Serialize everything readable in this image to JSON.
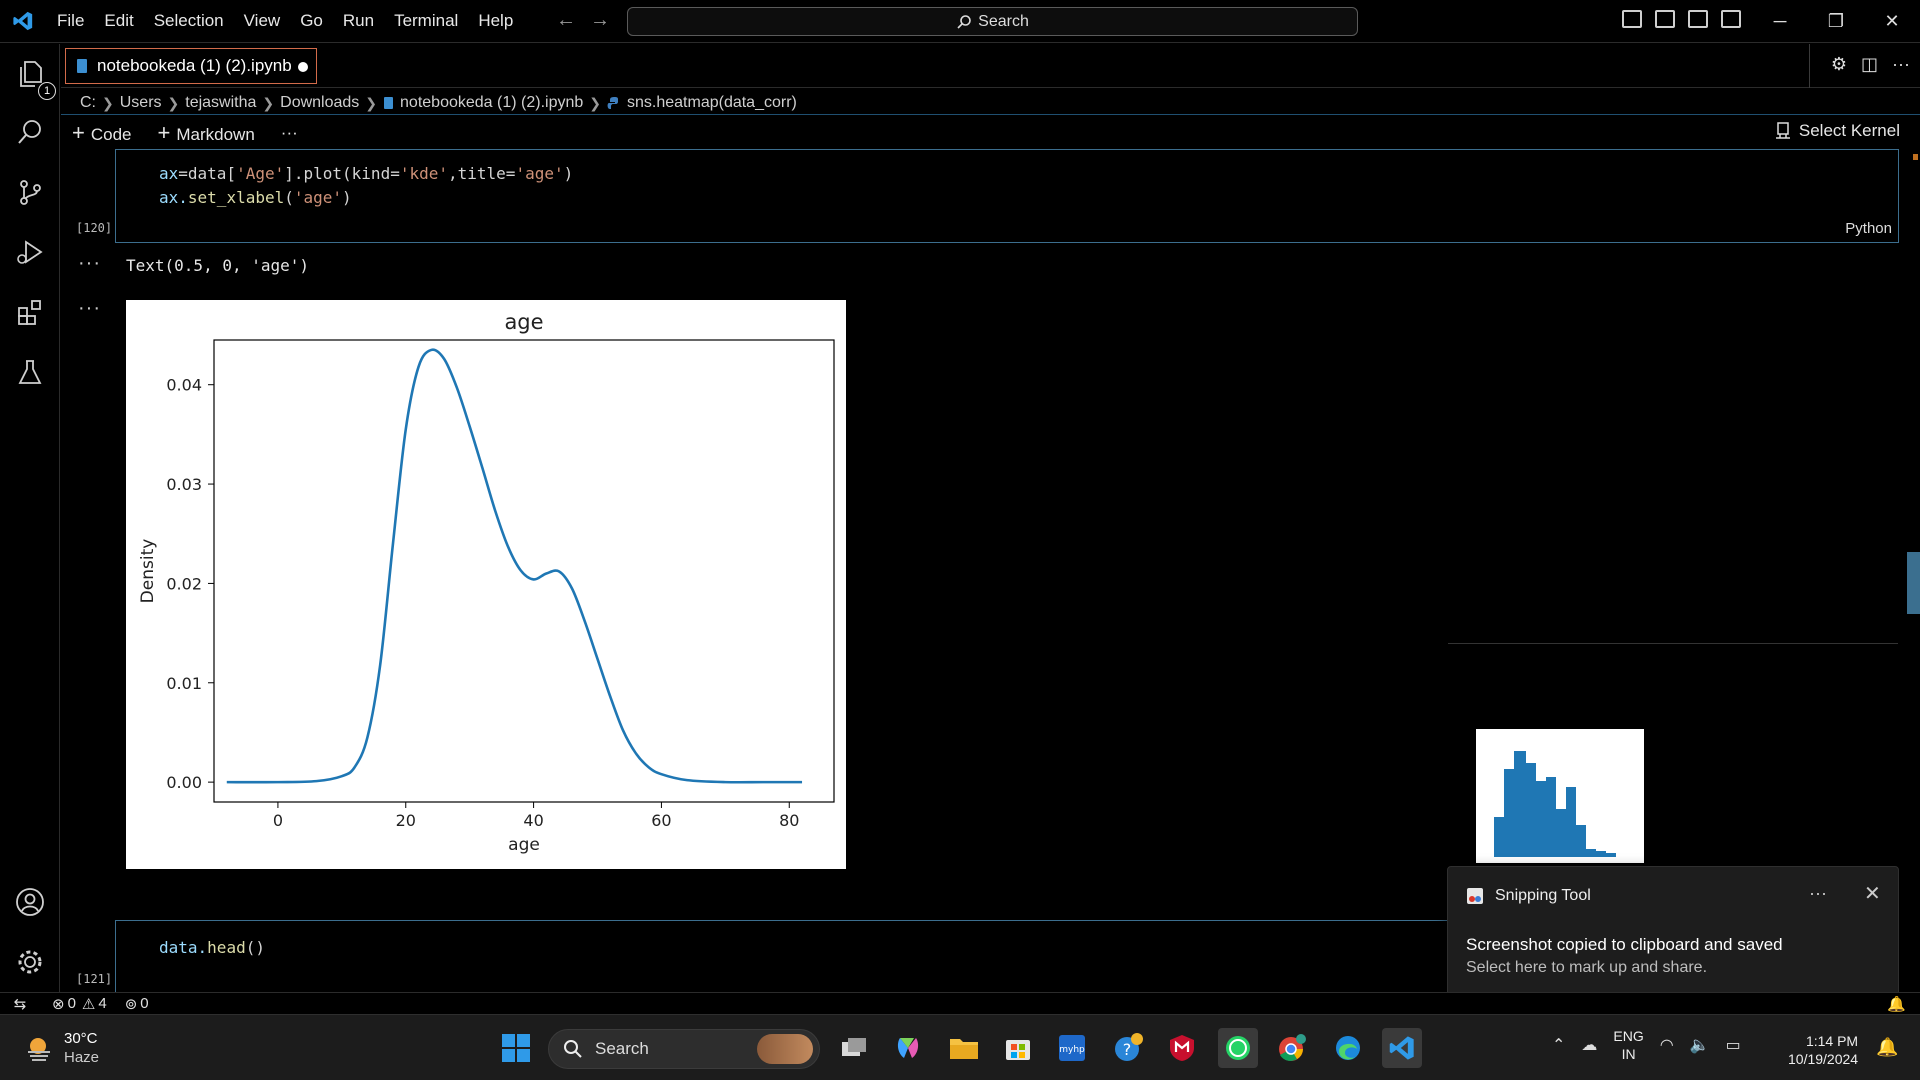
{
  "menu": [
    "File",
    "Edit",
    "Selection",
    "View",
    "Go",
    "Run",
    "Terminal",
    "Help"
  ],
  "search": {
    "label": "Search"
  },
  "tab": {
    "label": "notebookeda (1) (2).ipynb"
  },
  "explorer_badge": "1",
  "breadcrumb": [
    "C:",
    "Users",
    "tejaswitha",
    "Downloads",
    "notebookeda (1) (2).ipynb",
    "sns.heatmap(data_corr)"
  ],
  "toolbar": {
    "code": "Code",
    "markdown": "Markdown",
    "more": "···",
    "kernel": "Select Kernel"
  },
  "cell1": {
    "exec": "[120]",
    "lang": "Python",
    "line1": {
      "a": "ax",
      "b": "=data[",
      "c": "'Age'",
      "d": "].plot(kind=",
      "e": "'kde'",
      "f": ",title=",
      "g": "'age'",
      "h": ")"
    },
    "line2": {
      "a": "ax.",
      "b": "set_xlabel",
      "c": "(",
      "d": "'age'",
      "e": ")"
    }
  },
  "output": {
    "dots": "···",
    "text": "Text(0.5, 0, 'age')"
  },
  "chart_data": {
    "type": "line",
    "title": "age",
    "xlabel": "age",
    "ylabel": "Density",
    "xlim": [
      -10,
      87
    ],
    "ylim": [
      -0.002,
      0.0445
    ],
    "xticks": [
      0,
      20,
      40,
      60,
      80
    ],
    "yticks": [
      0.0,
      0.01,
      0.02,
      0.03,
      0.04
    ],
    "ytick_labels": [
      "0.00",
      "0.01",
      "0.02",
      "0.03",
      "0.04"
    ],
    "xtick_labels": [
      "0",
      "20",
      "40",
      "60",
      "80"
    ],
    "color": "#1f77b4",
    "x": [
      -8,
      0,
      6,
      10,
      12,
      14,
      16,
      18,
      20,
      22,
      24,
      26,
      28,
      30,
      32,
      34,
      36,
      38,
      40,
      42,
      44,
      46,
      48,
      50,
      52,
      54,
      56,
      58,
      60,
      64,
      70,
      76,
      82
    ],
    "y": [
      0.0,
      0.0,
      0.0001,
      0.0006,
      0.0015,
      0.0045,
      0.0118,
      0.024,
      0.0355,
      0.0418,
      0.0435,
      0.0426,
      0.0397,
      0.0358,
      0.0316,
      0.0273,
      0.0237,
      0.0213,
      0.0204,
      0.021,
      0.0212,
      0.0195,
      0.0162,
      0.0124,
      0.0086,
      0.0052,
      0.0029,
      0.0015,
      0.0008,
      0.0002,
      0.0,
      0.0,
      0.0
    ]
  },
  "cell2": {
    "exec": "[121]",
    "a": "data.",
    "b": "head",
    "c": "()"
  },
  "toast": {
    "app": "Snipping Tool",
    "title": "Screenshot copied to clipboard and saved",
    "body": "Select here to mark up and share.",
    "more": "···"
  },
  "status": {
    "errors": "0",
    "warnings": "4",
    "ports": "0"
  },
  "taskbar": {
    "temp": "30°C",
    "weather": "Haze",
    "search": "Search",
    "lang1": "ENG",
    "lang2": "IN",
    "time": "1:14 PM",
    "date": "10/19/2024"
  },
  "colors": {
    "accent": "#3c6e8e",
    "tab_border": "#d36b4a",
    "series": "#1f77b4"
  }
}
